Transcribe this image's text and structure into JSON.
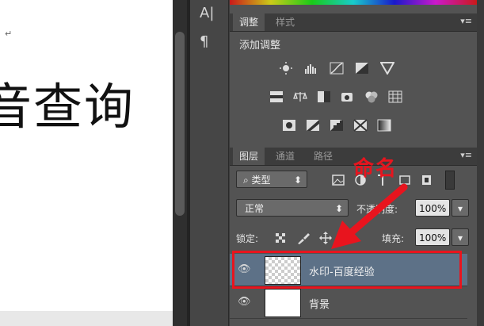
{
  "document": {
    "paragraph_mark": "↵",
    "big_text": "音查询"
  },
  "toolbar_icons": [
    "text-tool-icon",
    "paragraph-icon"
  ],
  "adjustments_panel": {
    "tabs": [
      {
        "label": "调整",
        "active": true
      },
      {
        "label": "样式",
        "active": false
      }
    ],
    "title": "添加调整",
    "icons": [
      "brightness-icon",
      "levels-icon",
      "curves-icon",
      "exposure-icon",
      "vibrance-icon",
      "color-balance-icon",
      "balance-icon",
      "bw-icon",
      "photo-filter-icon",
      "channel-mixer-icon",
      "color-lookup-icon",
      "invert-icon",
      "posterize-icon",
      "threshold-icon",
      "selective-color-icon",
      "gradient-map-icon"
    ]
  },
  "layers_panel": {
    "tabs": [
      {
        "label": "图层",
        "active": true
      },
      {
        "label": "通道",
        "active": false
      },
      {
        "label": "路径",
        "active": false
      }
    ],
    "filter": {
      "label": "类型"
    },
    "blend_mode": "正常",
    "opacity": {
      "label": "不透明度:",
      "value": "100%"
    },
    "lock_label": "锁定:",
    "fill": {
      "label": "填充:",
      "value": "100%"
    },
    "layers": [
      {
        "name": "水印-百度经验",
        "selected": true
      },
      {
        "name": "背景",
        "selected": false
      }
    ]
  },
  "annotation": {
    "text": "命名",
    "color": "#e8141e"
  }
}
